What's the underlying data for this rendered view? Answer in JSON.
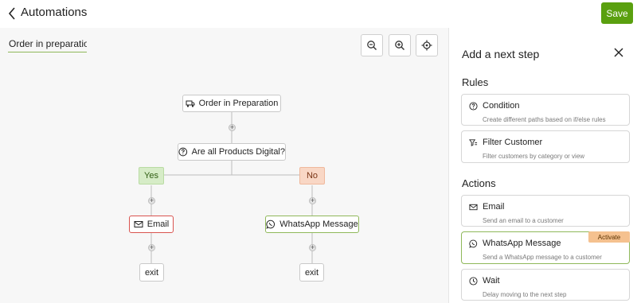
{
  "header": {
    "title": "Automations",
    "save_label": "Save"
  },
  "canvas": {
    "automation_name": "Order in preparation",
    "tools": [
      "zoom-out-icon",
      "zoom-in-icon",
      "recenter-icon"
    ]
  },
  "flow": {
    "trigger_label": "Order in Preparation",
    "condition_label": "Are all Products Digital?",
    "yes_label": "Yes",
    "no_label": "No",
    "email_label": "Email",
    "whatsapp_label": "WhatsApp Message",
    "exit_left_label": "exit",
    "exit_right_label": "exit",
    "plus_symbol": "+"
  },
  "panel": {
    "title": "Add a next step",
    "rules_title": "Rules",
    "actions_title": "Actions",
    "rules": [
      {
        "label": "Condition",
        "desc": "Create different paths based on if/else rules",
        "icon": "question-circle-icon"
      },
      {
        "label": "Filter Customer",
        "desc": "Filter customers by category or view",
        "icon": "filter-icon"
      }
    ],
    "actions": [
      {
        "label": "Email",
        "desc": "Send an email to a customer",
        "icon": "envelope-icon"
      },
      {
        "label": "WhatsApp Message",
        "desc": "Send a WhatsApp message to a customer",
        "icon": "whatsapp-icon",
        "badge": "Activate"
      },
      {
        "label": "Wait",
        "desc": "Delay moving to the next step",
        "icon": "clock-icon"
      }
    ]
  },
  "colors": {
    "save_green": "#5aa00f",
    "yes_bg": "#d6ecc7",
    "no_bg": "#f9d7c5",
    "email_border": "#d9534f",
    "whatsapp_border": "#8fb85a",
    "activate_badge": "#f5c18f"
  }
}
